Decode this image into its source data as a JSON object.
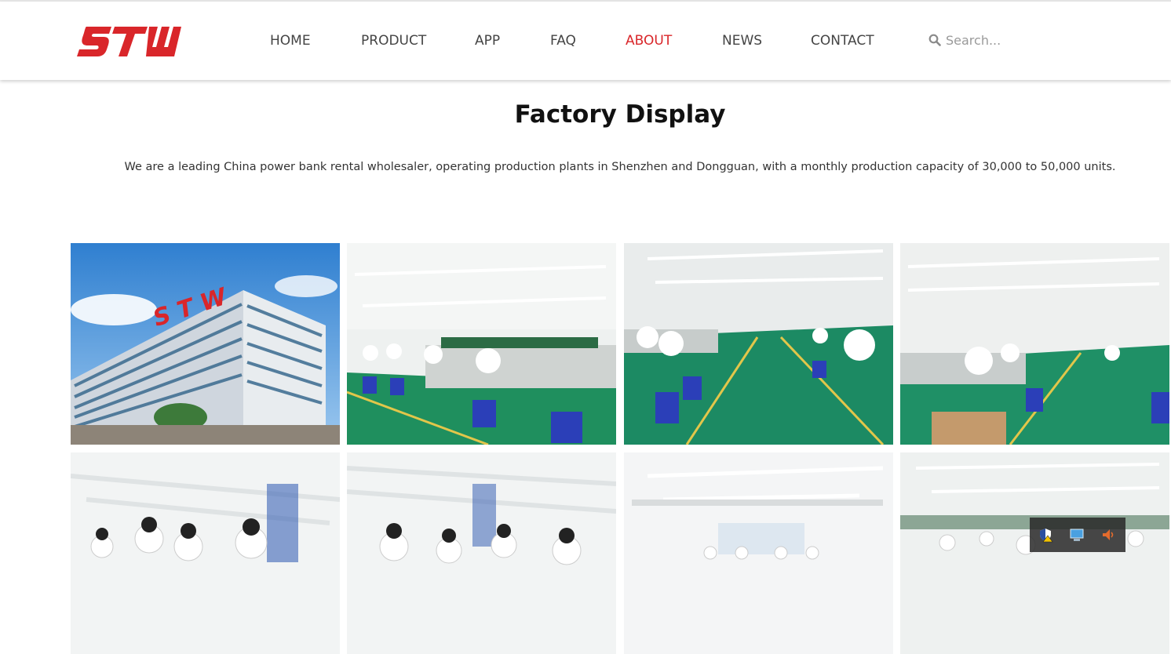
{
  "brand": {
    "logo_text": "STW",
    "registered_mark": "®",
    "color": "#d9262a"
  },
  "nav": {
    "items": [
      {
        "label": "HOME",
        "active": false
      },
      {
        "label": "PRODUCT",
        "active": false
      },
      {
        "label": "APP",
        "active": false
      },
      {
        "label": "FAQ",
        "active": false
      },
      {
        "label": "ABOUT",
        "active": true
      },
      {
        "label": "NEWS",
        "active": false
      },
      {
        "label": "CONTACT",
        "active": false
      }
    ],
    "active_color": "#d9262a",
    "text_color": "#444444"
  },
  "search": {
    "placeholder": "Search...",
    "value": "",
    "icon": "search-icon"
  },
  "section": {
    "title": "Factory Display",
    "description": "We are a leading China power bank rental wholesaler, operating production plants in Shenzhen and Dongguan, with a monthly production capacity of 30,000 to 50,000 units."
  },
  "gallery": {
    "photos": [
      {
        "subject": "factory-building"
      },
      {
        "subject": "assembly-line"
      },
      {
        "subject": "assembly-line"
      },
      {
        "subject": "assembly-line"
      },
      {
        "subject": "assembly-line"
      },
      {
        "subject": "assembly-line"
      },
      {
        "subject": "assembly-line"
      },
      {
        "subject": "assembly-line"
      }
    ]
  },
  "tray": {
    "icons": [
      "shield-warning-icon",
      "network-icon",
      "volume-warning-icon"
    ]
  }
}
